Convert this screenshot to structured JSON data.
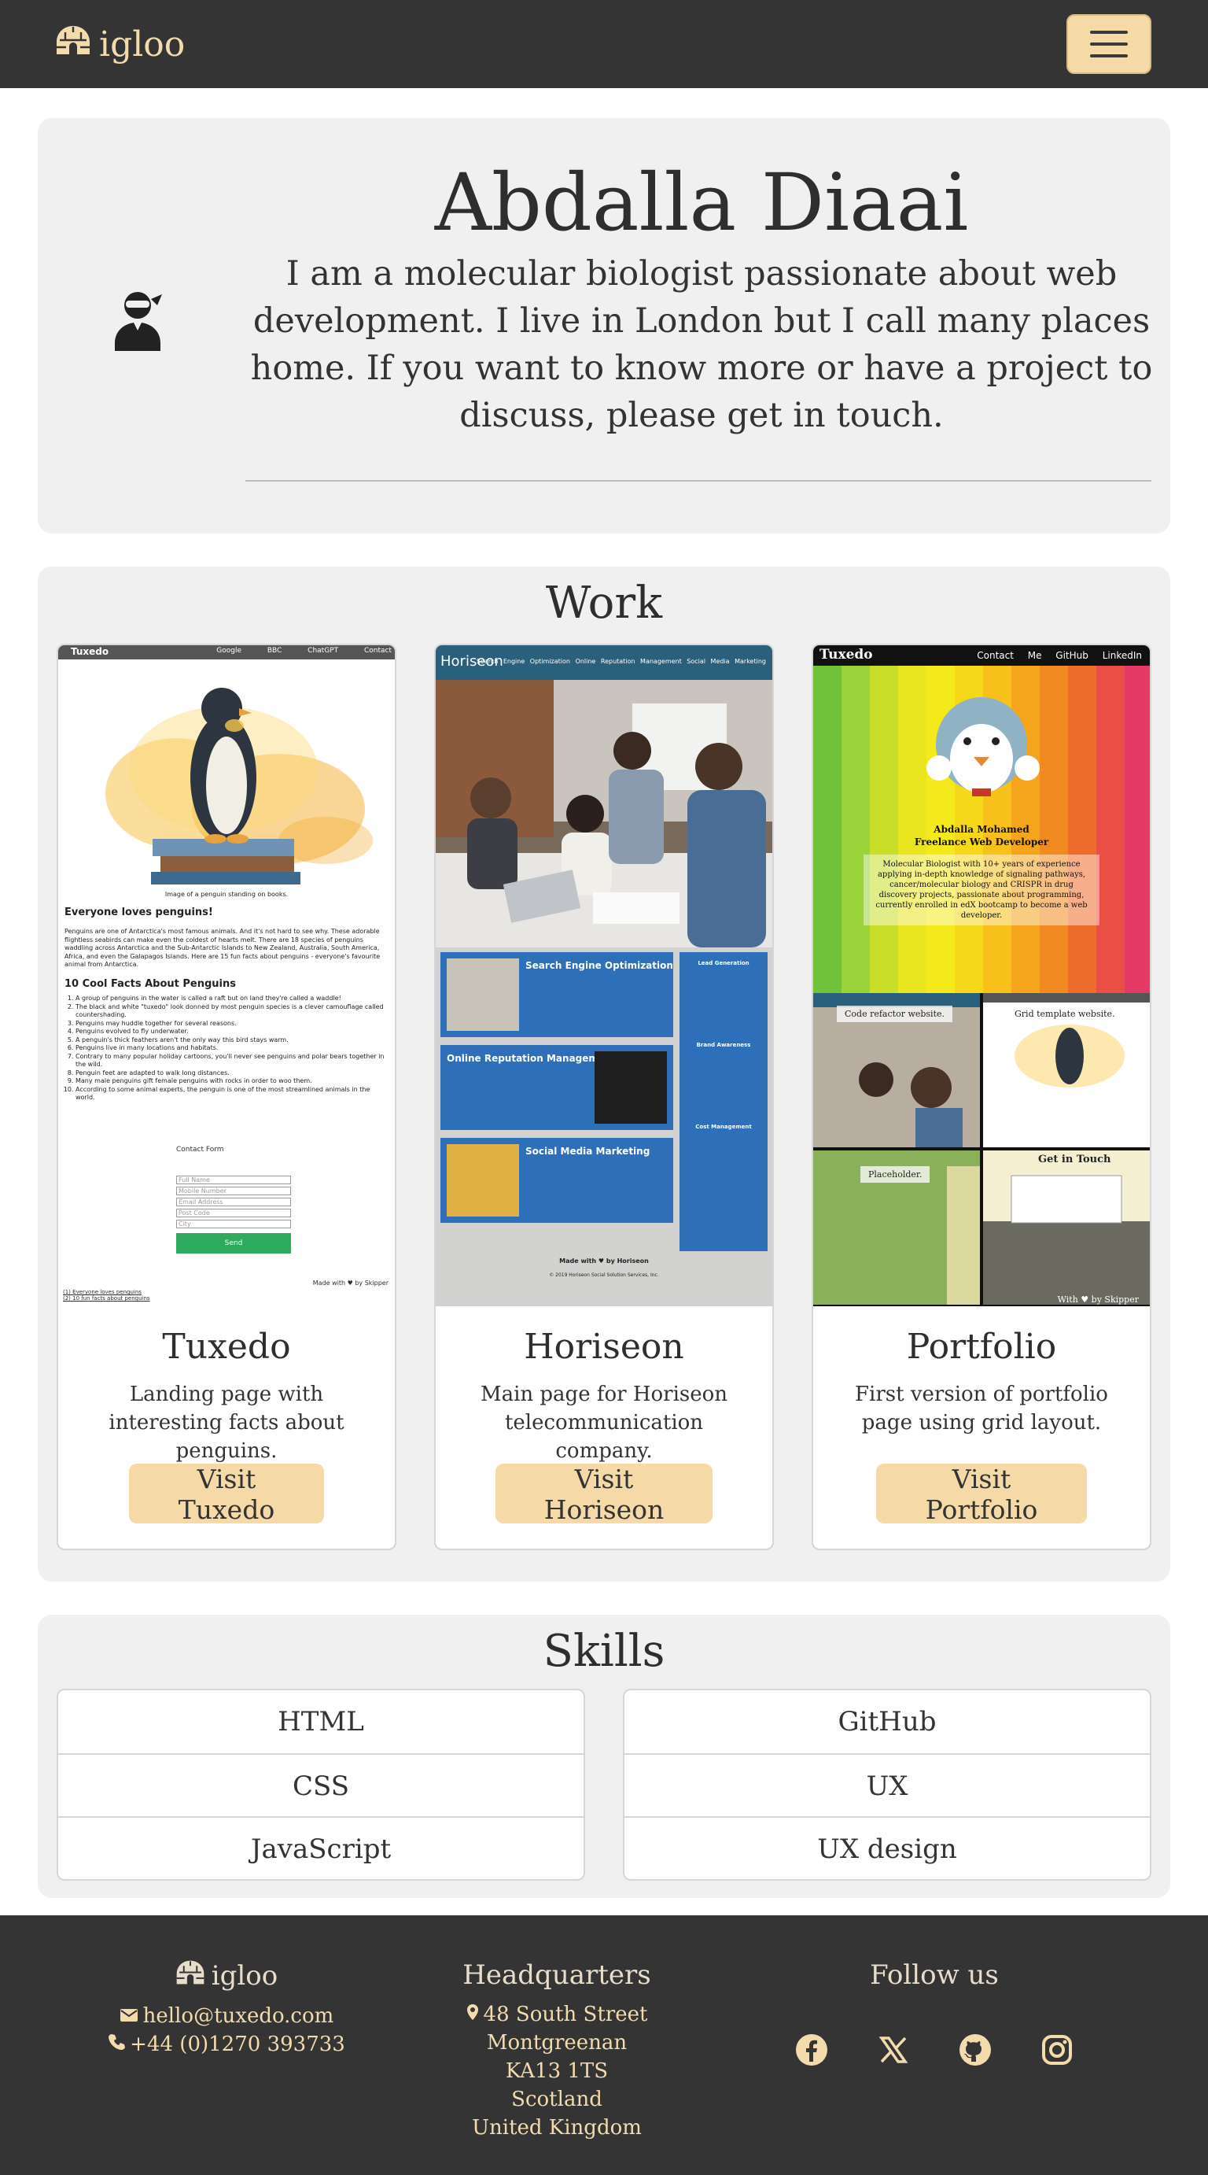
{
  "navbar": {
    "brand": "igloo",
    "brand_icon": "igloo-icon",
    "menu_icon": "hamburger-menu-icon"
  },
  "hero": {
    "avatar_icon": "user-ninja-icon",
    "title": "Abdalla Diaai",
    "intro": "I am a molecular biologist passionate about web development. I live in London but I call many places home. If you want to know more or have a project to discuss, please get in touch."
  },
  "work": {
    "title": "Work",
    "projects": [
      {
        "name": "Tuxedo",
        "description": "Landing page with interesting facts about penguins.",
        "button": "Visit Tuxedo",
        "preview": {
          "brand": "Tuxedo",
          "nav": "Google BBC ChatGPT Contact",
          "caption": "Image of a penguin standing on books.",
          "heading": "Everyone loves penguins!",
          "intro": "Penguins are one of Antarctica's most famous animals. And it's not hard to see why. These adorable flightless seabirds can make even the coldest of hearts melt. There are 18 species of penguins waddling across Antarctica and the Sub-Antarctic Islands to New Zealand, Australia, South America, Africa, and even the Galapagos Islands. Here are 15 fun facts about penguins - everyone's favourite animal from Antarctica.",
          "facts_heading": "10 Cool Facts About Penguins",
          "facts": [
            "A group of penguins in the water is called a raft but on land they're called a waddle!",
            "The black and white \"tuxedo\" look donned by most penguin species is a clever camouflage called countershading.",
            "Penguins may huddle together for several reasons.",
            "Penguins evolved to fly underwater.",
            "A penguin's thick feathers aren't the only way this bird stays warm.",
            "Penguins live in many locations and habitats.",
            "Contrary to many popular holiday cartoons, you'll never see penguins and polar bears together in the wild.",
            "Penguin feet are adapted to walk long distances.",
            "Many male penguins gift female penguins with rocks in order to woo them.",
            "According to some animal experts, the penguin is one of the most streamlined animals in the world."
          ],
          "form_title": "Contact Form",
          "fields": [
            "Full Name",
            "Mobile Number",
            "Email Address",
            "Post Code",
            "City"
          ],
          "send": "Send",
          "made_with": "Made with ♥ by Skipper",
          "links": [
            "(1) Everyone loves penguins",
            "(2) 10 fun facts about penguins"
          ]
        }
      },
      {
        "name": "Horiseon",
        "description": "Main page for Horiseon telecommunication company.",
        "button": "Visit Horiseon",
        "preview": {
          "brand": "Horiseon",
          "nav": "Search Engine Optimization  Online Reputation Management  Social Media Marketing",
          "cards": [
            "Search Engine Optimization",
            "Online Reputation Management",
            "Social Media Marketing"
          ],
          "side": [
            "Lead Generation",
            "Brand Awareness",
            "Cost Management"
          ],
          "footer": "Made with ♥ by Horiseon",
          "copyright": "© 2019 Horiseon Social Solution Services, Inc."
        }
      },
      {
        "name": "Portfolio",
        "description": "First version of portfolio page using grid layout.",
        "button": "Visit Portfolio",
        "preview": {
          "brand": "Tuxedo",
          "nav": "Contact Me GitHub LinkedIn",
          "name_line": "Abdalla Mohamed",
          "role": "Freelance Web Developer",
          "bio": "Molecular Biologist with 10+ years of experience applying in-depth knowledge of signaling pathways, cancer/molecular biology and CRISPR in drug discovery projects, passionate about programming, currently enrolled in edX bootcamp to become a web developer.",
          "tiles": [
            "Code refactor website.",
            "Grid template website.",
            "Placeholder.",
            "Get in Touch"
          ],
          "footer": "With ♥ by Skipper"
        }
      }
    ]
  },
  "skills": {
    "title": "Skills",
    "left": [
      "HTML",
      "CSS",
      "JavaScript"
    ],
    "right": [
      "GitHub",
      "UX",
      "UX design"
    ]
  },
  "footer": {
    "brand": "igloo",
    "email": "hello@tuxedo.com",
    "phone": "+44 (0)1270 393733",
    "hq_title": "Headquarters",
    "address": [
      "48 South Street",
      "Montgreenan",
      "KA13 1TS",
      "Scotland",
      "United Kingdom"
    ],
    "follow_title": "Follow us",
    "social_icons": [
      "facebook-icon",
      "x-twitter-icon",
      "github-icon",
      "instagram-icon"
    ]
  },
  "colors": {
    "nav_bg": "#343434",
    "accent": "#f5d9a6",
    "section_bg": "#f0f0f0",
    "footer_text": "#f4dbad"
  }
}
